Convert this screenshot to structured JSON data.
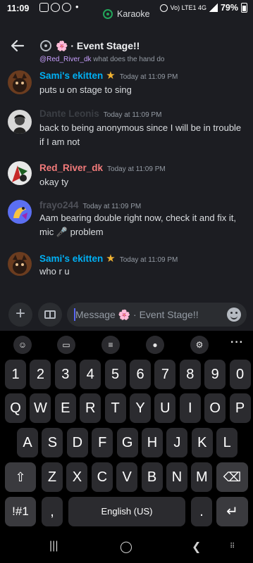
{
  "status": {
    "time": "11:09",
    "battery": "79%",
    "net": "Vo) LTE1 4G"
  },
  "karaoke": {
    "label": "Karaoke"
  },
  "header": {
    "title": "🌸 · Event Stage!!"
  },
  "reply": {
    "name": "@Red_River_dk",
    "text": "what does the hand do"
  },
  "messages": [
    {
      "user": "Sami's ekitten",
      "color": "#00b0f4",
      "star": "★",
      "time": "Today at 11:09 PM",
      "text": "puts u on stage to sing"
    },
    {
      "user": "Dante Leonis",
      "color": "#3b3e44",
      "star": "",
      "time": "Today at 11:09 PM",
      "text": "back to being anonymous since I will be in trouble if I am not"
    },
    {
      "user": "Red_River_dk",
      "color": "#f47b7b",
      "star": "",
      "time": "Today at 11:09 PM",
      "text": "okay ty"
    },
    {
      "user": "frayo244",
      "color": "#4e5058",
      "star": "",
      "time": "Today at 11:09 PM",
      "text": "Aam bearing double right now, check it and fix it, mic 🎤 problem"
    },
    {
      "user": "Sami's ekitten",
      "color": "#00b0f4",
      "star": "★",
      "time": "Today at 11:09 PM",
      "text": "who r u"
    }
  ],
  "input": {
    "placeholder": "Message 🌸 · Event Stage!!"
  },
  "keyboard": {
    "row1": [
      "1",
      "2",
      "3",
      "4",
      "5",
      "6",
      "7",
      "8",
      "9",
      "0"
    ],
    "row2": [
      "Q",
      "W",
      "E",
      "R",
      "T",
      "Y",
      "U",
      "I",
      "O",
      "P"
    ],
    "row3": [
      "A",
      "S",
      "D",
      "F",
      "G",
      "H",
      "J",
      "K",
      "L"
    ],
    "row4": [
      "Z",
      "X",
      "C",
      "V",
      "B",
      "N",
      "M"
    ],
    "symbols": "!#1",
    "comma": ",",
    "space": "English (US)",
    "period": ".",
    "enter": "↵",
    "shift": "⇧",
    "backspace": "⌫"
  },
  "nav": {
    "recents": "|||",
    "home": "◯",
    "back": "❮"
  }
}
